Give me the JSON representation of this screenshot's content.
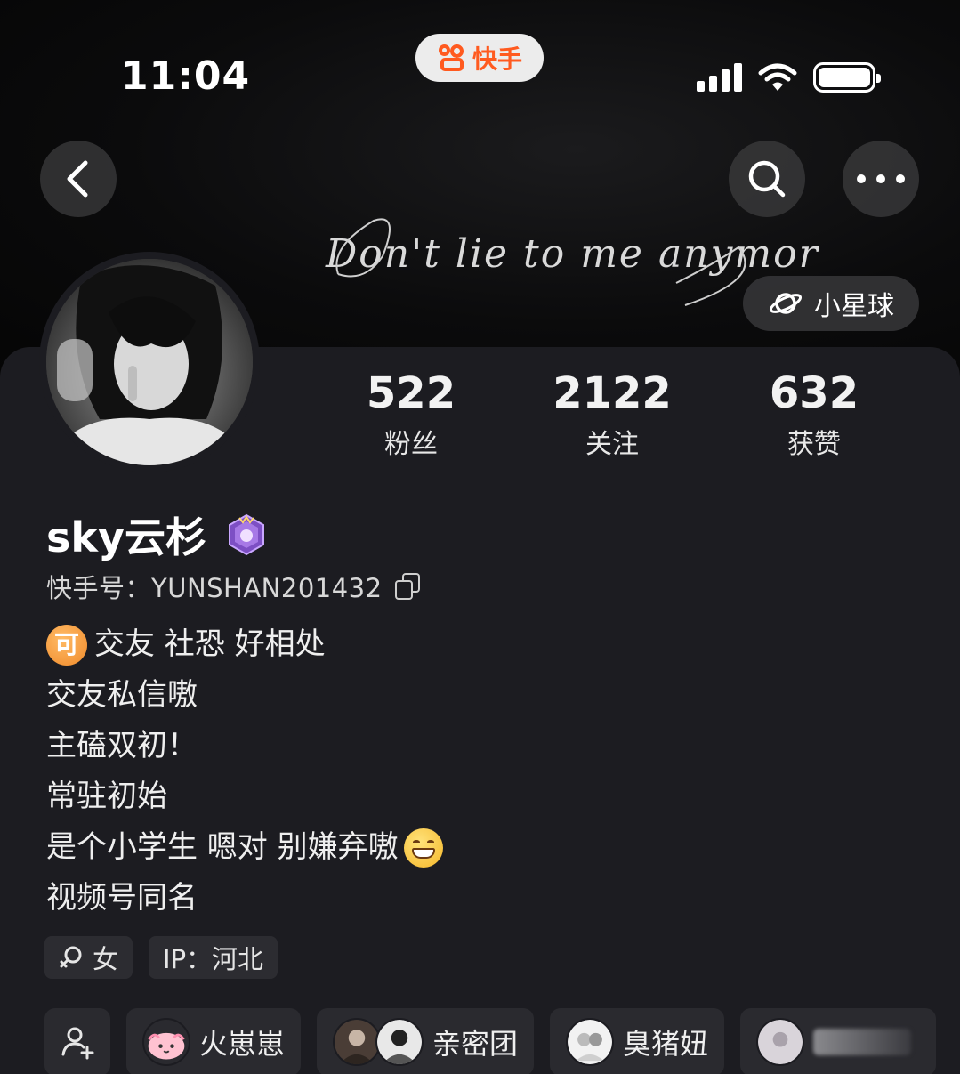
{
  "status_bar": {
    "time": "11:04",
    "app_name": "快手"
  },
  "banner": {
    "script_text": "Don't lie to me anymore",
    "planet_label": "小星球"
  },
  "stats": [
    {
      "value": "522",
      "label": "粉丝"
    },
    {
      "value": "2122",
      "label": "关注"
    },
    {
      "value": "632",
      "label": "获赞"
    }
  ],
  "profile": {
    "name": "sky云杉",
    "kuaishou_id": "快手号：YUNSHAN201432",
    "bio": {
      "line1": "交友 社恐 好相处",
      "coin_char": "可",
      "line2": "交友私信嗷",
      "line3": "主磕双初！",
      "line4": "常驻初始",
      "line5": "是个小学生 嗯对 别嫌弃嗷",
      "line6": "视频号同名"
    },
    "tags": {
      "gender": "女",
      "ip": "IP：河北"
    }
  },
  "friends": {
    "chip1": "火崽崽",
    "chip2": "亲密团",
    "chip3": "臭猪妞"
  },
  "colors": {
    "brand": "#ff5a1f",
    "card_bg": "#1c1c21",
    "chip_bg": "#2a2a2f"
  }
}
